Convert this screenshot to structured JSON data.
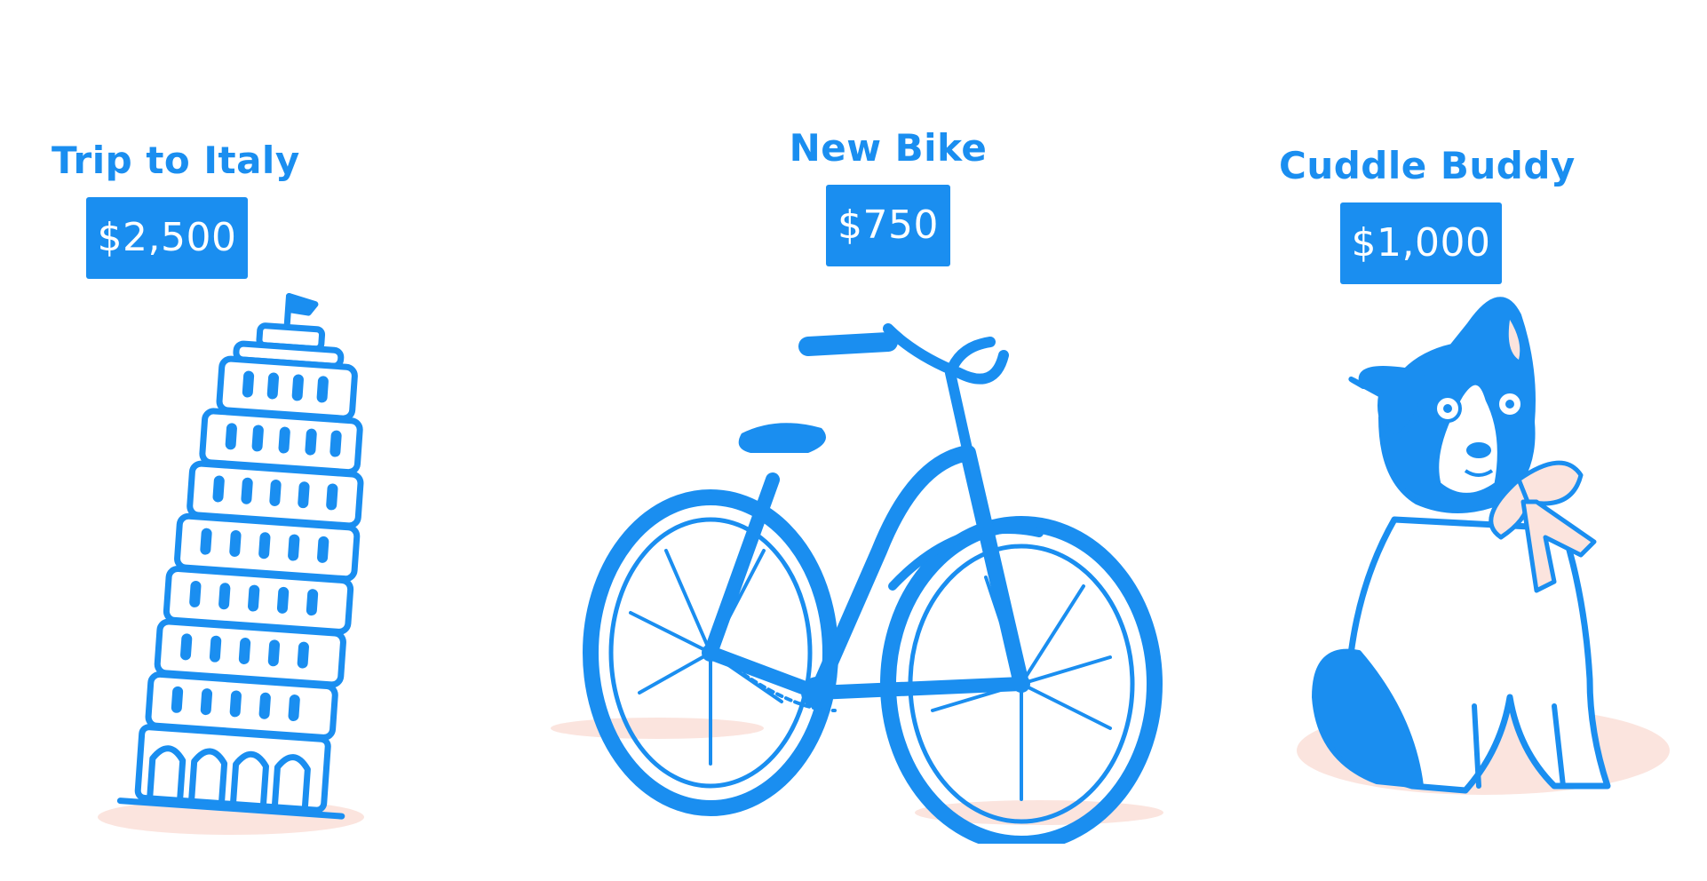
{
  "goals": [
    {
      "title": "Trip to Italy",
      "price": "$2,500",
      "illustration": "leaning-tower-of-pisa"
    },
    {
      "title": "New Bike",
      "price": "$750",
      "illustration": "bicycle"
    },
    {
      "title": "Cuddle Buddy",
      "price": "$1,000",
      "illustration": "dog-with-bow"
    }
  ],
  "colors": {
    "accent": "#1a8ef0",
    "blush": "#fbe4de",
    "background": "#ffffff"
  }
}
